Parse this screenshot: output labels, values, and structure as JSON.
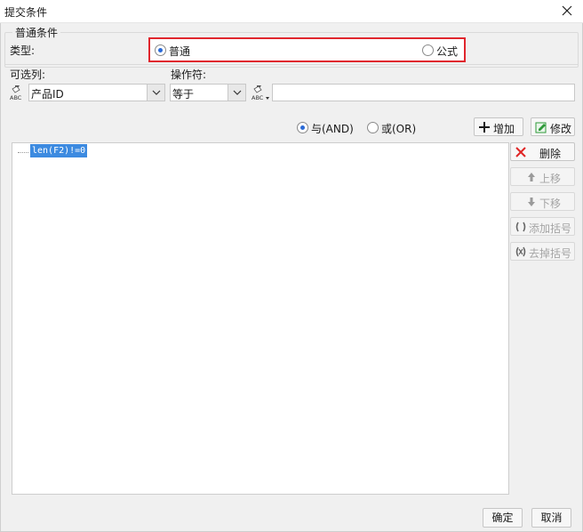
{
  "window": {
    "title": "提交条件"
  },
  "group": {
    "legend": "普通条件"
  },
  "type": {
    "label": "类型:",
    "options": [
      {
        "label": "普通",
        "checked": true
      },
      {
        "label": "公式",
        "checked": false
      }
    ],
    "highlight_color": "#e0262d"
  },
  "column": {
    "label": "可选列:",
    "selected": "产品ID",
    "icon": "abc-field-icon"
  },
  "operator": {
    "label": "操作符:",
    "selected": "等于"
  },
  "value_field": {
    "icon": "abc-field-icon",
    "value": ""
  },
  "logic": {
    "and_label": "与(AND)",
    "or_label": "或(OR)",
    "selected": "and"
  },
  "actions": {
    "add": "增加",
    "modify": "修改",
    "delete": "删除",
    "move_up": "上移",
    "move_down": "下移",
    "add_brackets": "添加括号",
    "remove_brackets": "去掉括号"
  },
  "conditions": [
    "len(F2)!=0"
  ],
  "footer": {
    "ok": "确定",
    "cancel": "取消"
  },
  "colors": {
    "accent": "#2b6ad6",
    "selection": "#3c8ae0",
    "delete_icon": "#e02424",
    "add_icon": "#1a1a1a",
    "modify_icon": "#2f9a3a"
  }
}
